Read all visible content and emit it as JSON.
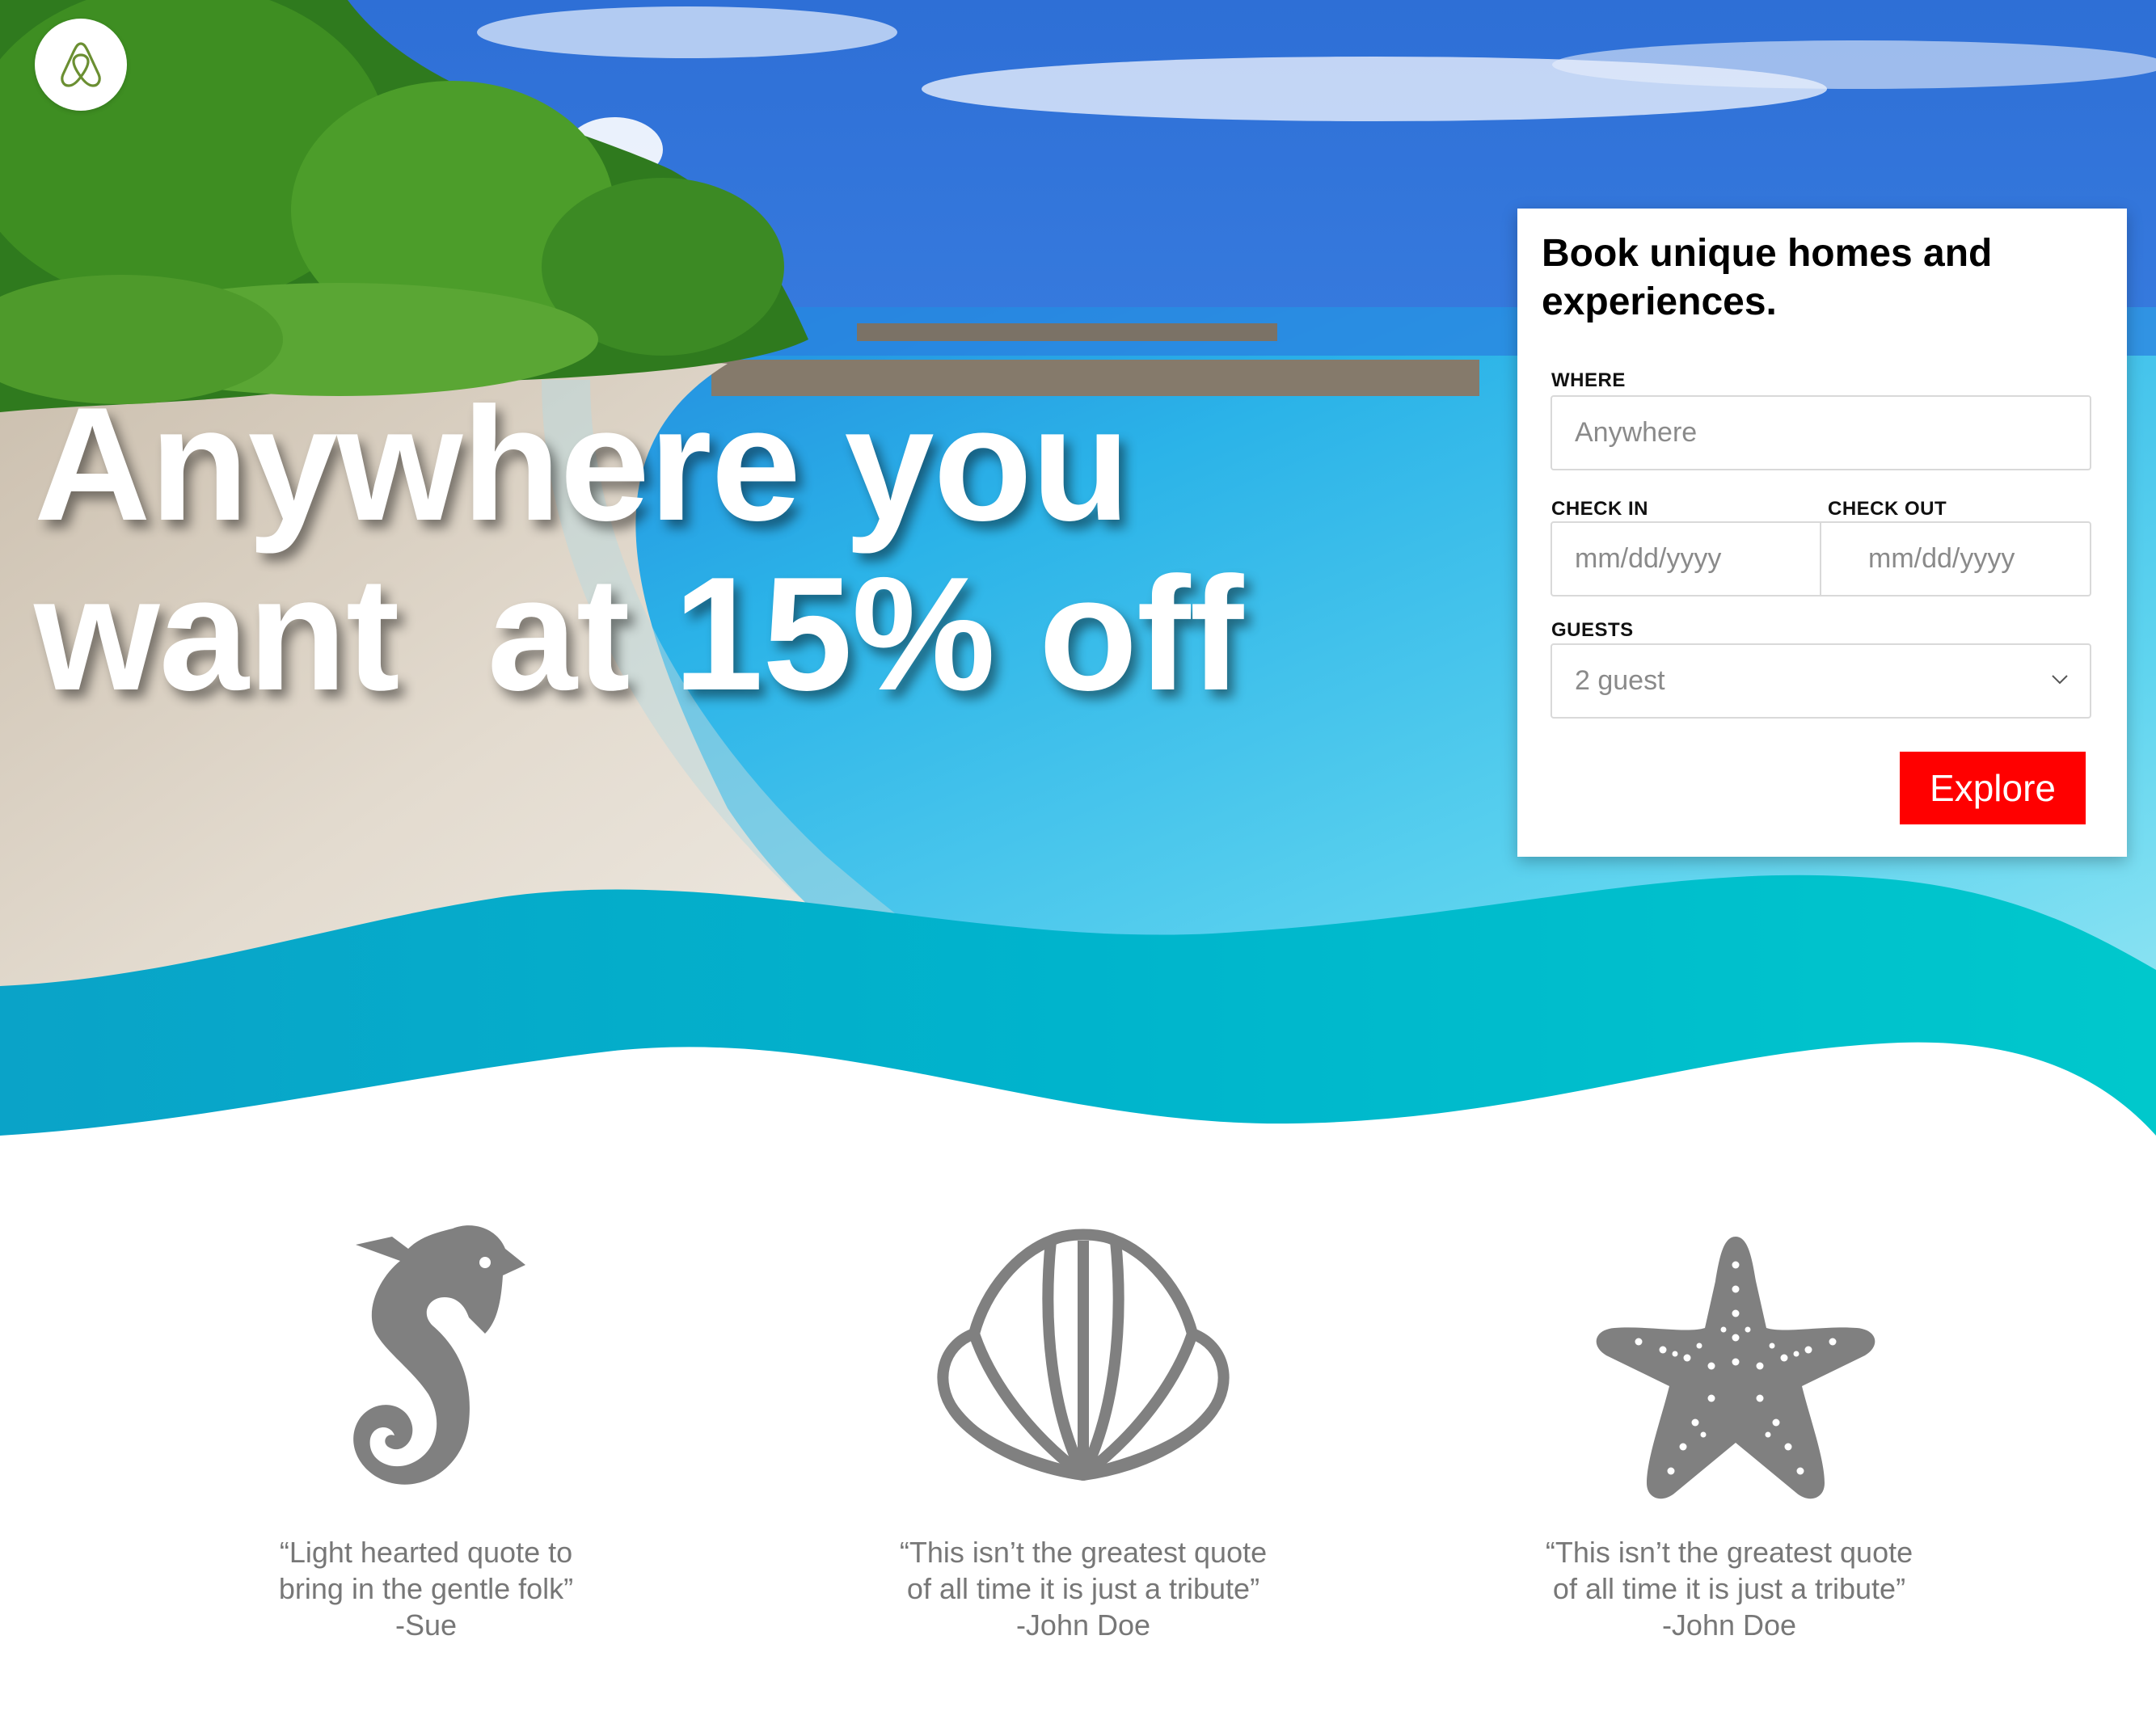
{
  "hero": {
    "headline_line1": "Anywhere you",
    "headline_line2": "want  at 15% off",
    "logo_icon": "airbnb-logo-icon"
  },
  "booking": {
    "title": "Book unique homes and experiences.",
    "where_label": "WHERE",
    "where_placeholder": "Anywhere",
    "checkin_label": "CHECK IN",
    "checkin_placeholder": "mm/dd/yyyy",
    "checkout_label": "CHECK OUT",
    "checkout_placeholder": "mm/dd/yyyy",
    "guests_label": "GUESTS",
    "guests_value": "2 guest",
    "explore_label": "Explore"
  },
  "testimonials": [
    {
      "icon": "seahorse-icon",
      "line1": "“Light hearted quote to",
      "line2": "bring in the gentle folk”",
      "author": "-Sue"
    },
    {
      "icon": "shell-icon",
      "line1": "“This isn’t the greatest quote",
      "line2": "of all time it is just a tribute”",
      "author": "-John Doe"
    },
    {
      "icon": "starfish-icon",
      "line1": "“This isn’t the greatest quote",
      "line2": "of all time it is just a tribute”",
      "author": "-John Doe"
    }
  ],
  "colors": {
    "accent": "#ff0000",
    "wave": "#00b4cc",
    "icon_gray": "#808080",
    "text_gray": "#777777"
  }
}
